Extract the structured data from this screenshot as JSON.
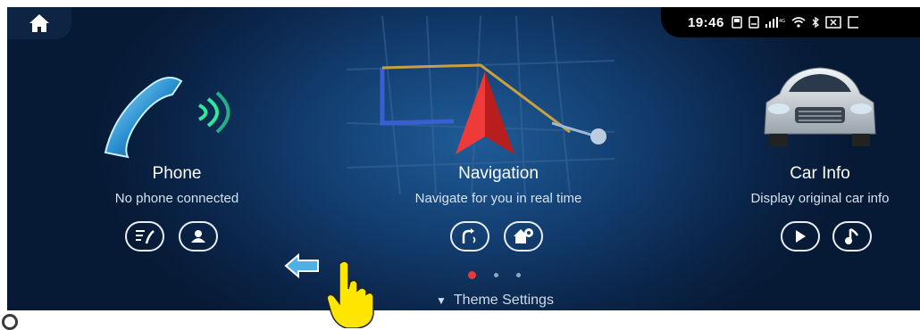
{
  "status": {
    "time": "19:46"
  },
  "cards": [
    {
      "title": "Phone",
      "subtitle": "No phone connected",
      "icon": "phone-handset-icon",
      "buttons": [
        {
          "icon": "call-list-icon"
        },
        {
          "icon": "contacts-icon"
        }
      ]
    },
    {
      "title": "Navigation",
      "subtitle": "Navigate for you in real time",
      "icon": "navigation-arrow-icon",
      "buttons": [
        {
          "icon": "voice-guidance-icon"
        },
        {
          "icon": "home-location-icon"
        }
      ]
    },
    {
      "title": "Car Info",
      "subtitle": "Display original car info",
      "icon": "car-icon",
      "buttons": [
        {
          "icon": "play-icon"
        },
        {
          "icon": "music-note-icon"
        }
      ]
    }
  ],
  "pager": {
    "count": 3,
    "active": 0
  },
  "theme_settings": {
    "label": "Theme Settings"
  },
  "colors": {
    "accent": "#e23c3c",
    "background": "#123c6e"
  }
}
